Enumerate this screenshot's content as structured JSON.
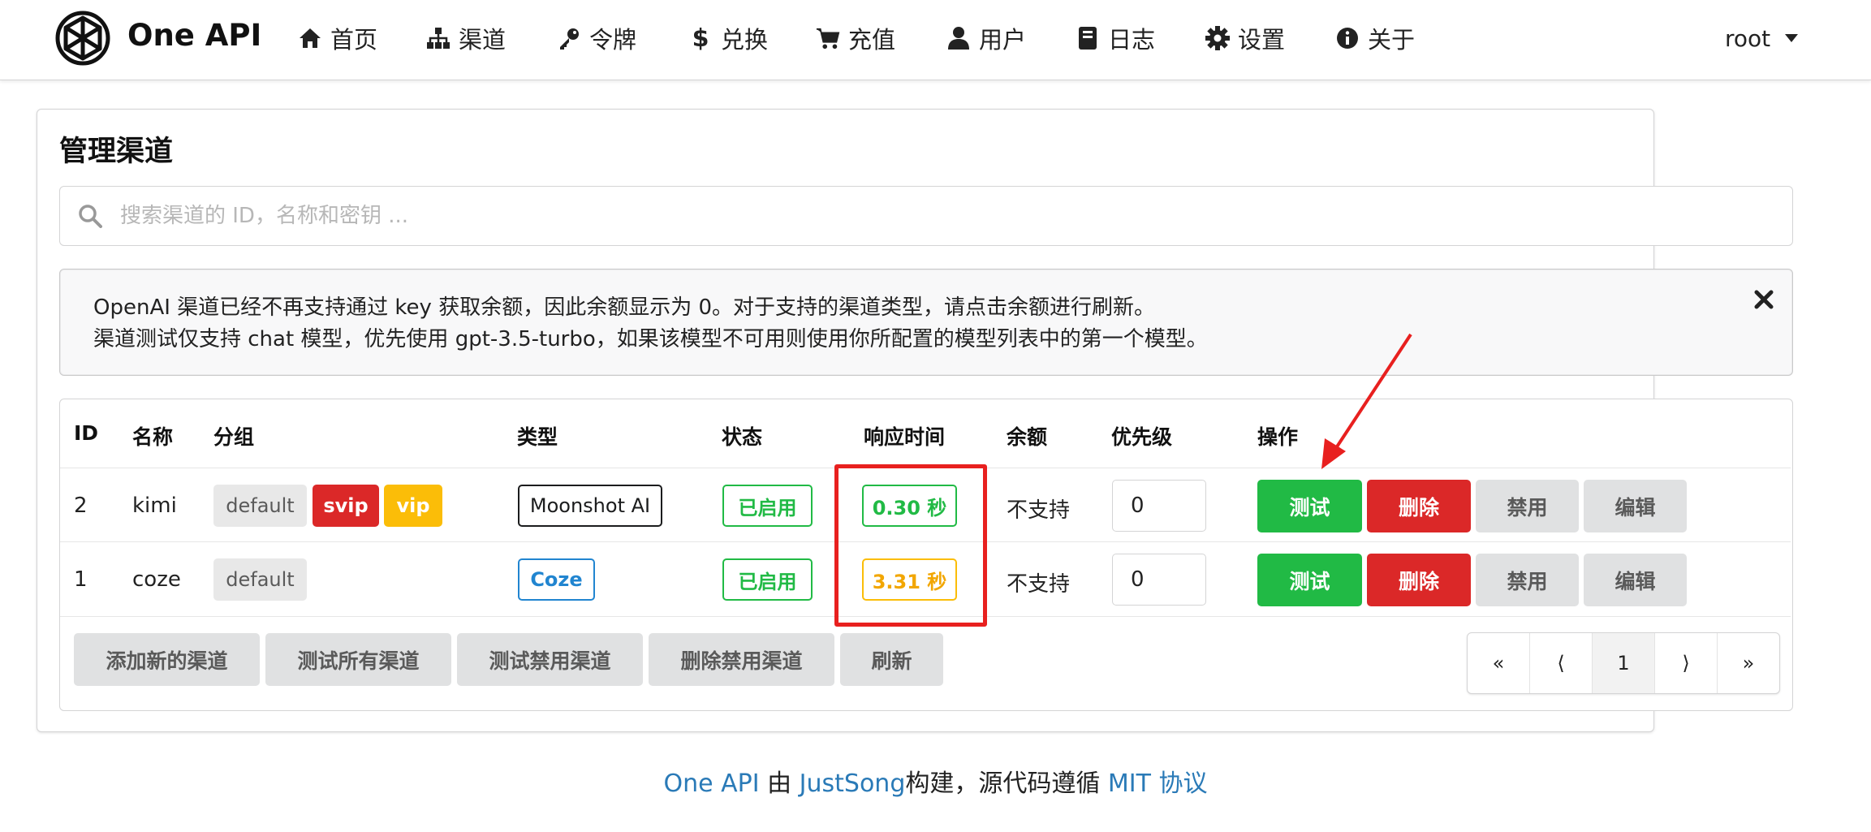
{
  "nav": {
    "brand": "One API",
    "items": [
      {
        "label": "首页",
        "icon": "home-icon"
      },
      {
        "label": "渠道",
        "icon": "sitemap-icon"
      },
      {
        "label": "令牌",
        "icon": "key-icon"
      },
      {
        "label": "兑换",
        "icon": "dollar-icon"
      },
      {
        "label": "充值",
        "icon": "cart-icon"
      },
      {
        "label": "用户",
        "icon": "user-icon"
      },
      {
        "label": "日志",
        "icon": "book-icon"
      },
      {
        "label": "设置",
        "icon": "gear-icon"
      },
      {
        "label": "关于",
        "icon": "info-icon"
      }
    ],
    "user": "root"
  },
  "page": {
    "title": "管理渠道",
    "search_placeholder": "搜索渠道的 ID，名称和密钥 ..."
  },
  "message": {
    "line1": "OpenAI 渠道已经不再支持通过 key 获取余额，因此余额显示为 0。对于支持的渠道类型，请点击余额进行刷新。",
    "line2": "渠道测试仅支持 chat 模型，优先使用 gpt-3.5-turbo，如果该模型不可用则使用你所配置的模型列表中的第一个模型。"
  },
  "table": {
    "headers": {
      "id": "ID",
      "name": "名称",
      "group": "分组",
      "type": "类型",
      "status": "状态",
      "response_time": "响应时间",
      "balance": "余额",
      "priority": "优先级",
      "actions": "操作"
    },
    "rows": [
      {
        "id": "2",
        "name": "kimi",
        "groups": [
          "default",
          "svip",
          "vip"
        ],
        "type": "Moonshot AI",
        "status": "已启用",
        "response_time": "0.30 秒",
        "balance": "不支持",
        "priority": "0",
        "actions": {
          "test": "测试",
          "delete": "删除",
          "disable": "禁用",
          "edit": "编辑"
        }
      },
      {
        "id": "1",
        "name": "coze",
        "groups": [
          "default"
        ],
        "type": "Coze",
        "status": "已启用",
        "response_time": "3.31 秒",
        "balance": "不支持",
        "priority": "0",
        "actions": {
          "test": "测试",
          "delete": "删除",
          "disable": "禁用",
          "edit": "编辑"
        }
      }
    ]
  },
  "footer_actions": {
    "add": "添加新的渠道",
    "test_all": "测试所有渠道",
    "test_disabled": "测试禁用渠道",
    "delete_disabled": "删除禁用渠道",
    "refresh": "刷新"
  },
  "pagination": {
    "first": "«",
    "prev": "⟨",
    "current": "1",
    "next": "⟩",
    "last": "»"
  },
  "footer": {
    "brand_link": "One API",
    "by": "由",
    "author_link": "JustSong",
    "built": "构建，源代码遵循",
    "license_link": "MIT 协议"
  },
  "colors": {
    "green": "#21ba45",
    "red": "#db2828",
    "yellow": "#fbbd08",
    "blue": "#2185d0",
    "annotation": "#e8201f"
  }
}
